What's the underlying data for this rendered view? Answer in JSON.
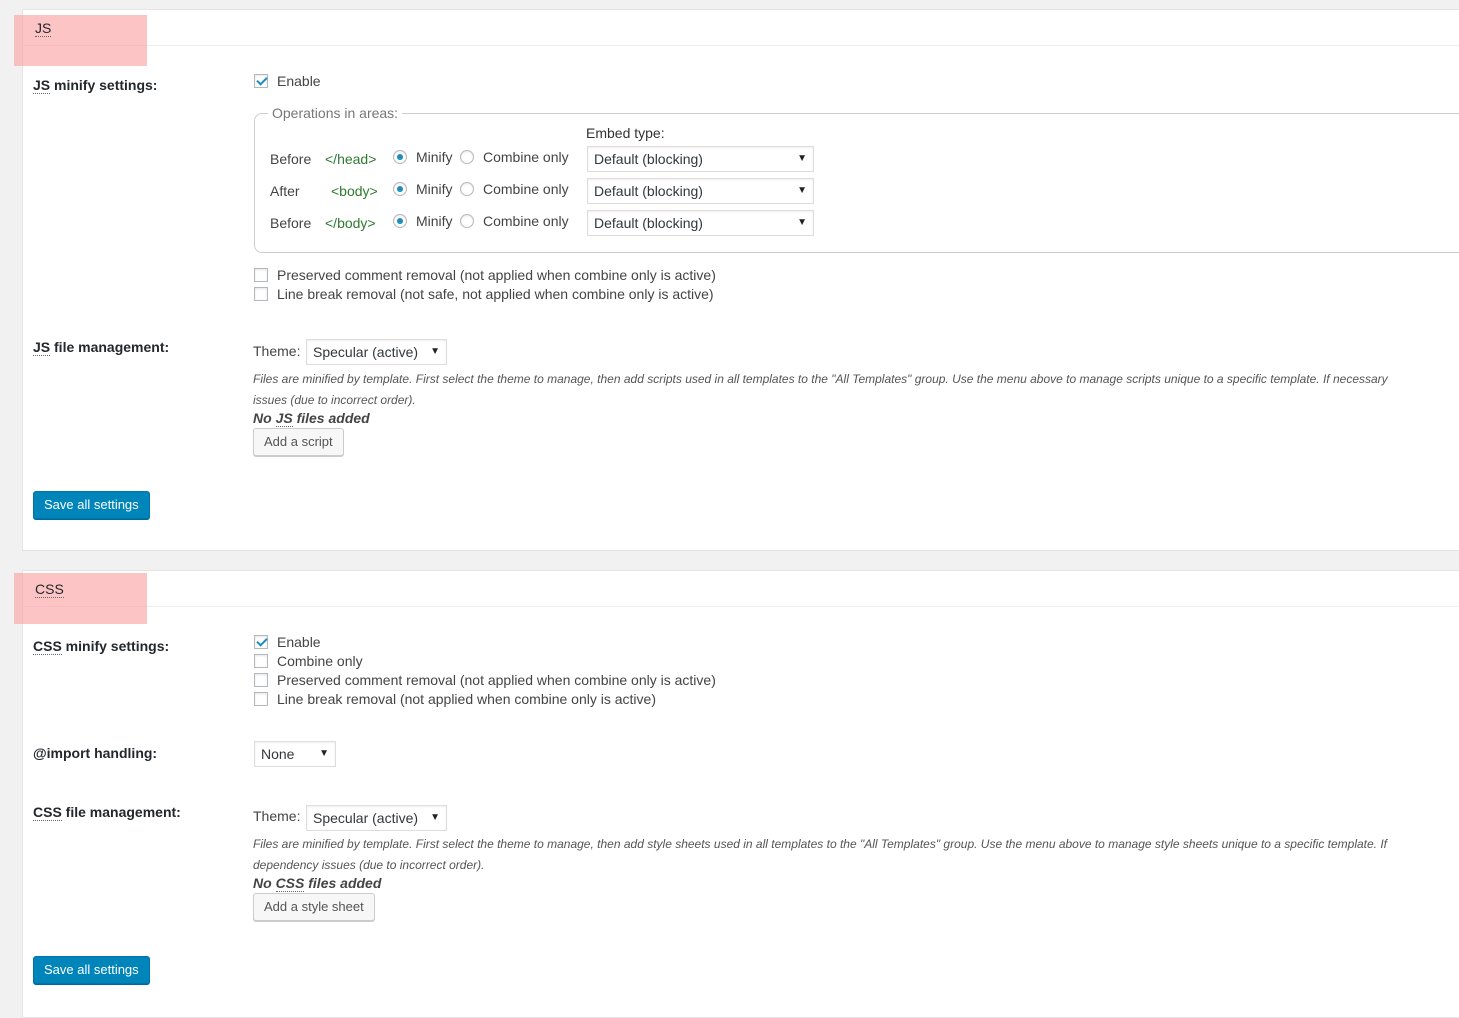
{
  "js": {
    "title_abbr": "JS",
    "minify_label_abbr": "JS",
    "minify_label_rest": " minify settings:",
    "enable_label": "Enable",
    "operations_legend": "Operations in areas:",
    "embed_type_label": "Embed type:",
    "rows": [
      {
        "prefix": "Before",
        "tag": "</head>",
        "minify": "Minify",
        "combine": "Combine only",
        "embed": "Default (blocking)"
      },
      {
        "prefix": "After",
        "tag": "<body>",
        "minify": "Minify",
        "combine": "Combine only",
        "embed": "Default (blocking)"
      },
      {
        "prefix": "Before",
        "tag": "</body>",
        "minify": "Minify",
        "combine": "Combine only",
        "embed": "Default (blocking)"
      }
    ],
    "preserved_comment": "Preserved comment removal (not applied when combine only is active)",
    "line_break": "Line break removal (not safe, not applied when combine only is active)",
    "file_mgmt_abbr": "JS",
    "file_mgmt_rest": " file management:",
    "theme_label": "Theme:",
    "theme_value": "Specular (active)",
    "desc_line1": "Files are minified by template. First select the theme to manage, then add scripts used in all templates to the \"All Templates\" group. Use the menu above to manage scripts unique to a specific template. If necessary",
    "desc_line2": "issues (due to incorrect order).",
    "no_files_pre": "No ",
    "no_files_abbr": "JS",
    "no_files_post": " files added",
    "add_button": "Add a script",
    "save_button": "Save all settings"
  },
  "css": {
    "title_abbr": "CSS",
    "minify_label_abbr": "CSS",
    "minify_label_rest": " minify settings:",
    "enable_label": "Enable",
    "combine_only": "Combine only",
    "preserved_comment": "Preserved comment removal (not applied when combine only is active)",
    "line_break": "Line break removal (not applied when combine only is active)",
    "import_label": "@import handling:",
    "import_value": "None",
    "file_mgmt_abbr": "CSS",
    "file_mgmt_rest": " file management:",
    "theme_label": "Theme:",
    "theme_value": "Specular (active)",
    "desc_line1": "Files are minified by template. First select the theme to manage, then add style sheets used in all templates to the \"All Templates\" group. Use the menu above to manage style sheets unique to a specific template. If",
    "desc_line2": "dependency issues (due to incorrect order).",
    "no_files_pre": "No ",
    "no_files_abbr": "CSS",
    "no_files_post": " files added",
    "add_button": "Add a style sheet",
    "save_button": "Save all settings"
  },
  "colors": {
    "accent": "#0085ba",
    "tag_green": "#2f7a2f",
    "highlight": "#f7a8a8"
  }
}
